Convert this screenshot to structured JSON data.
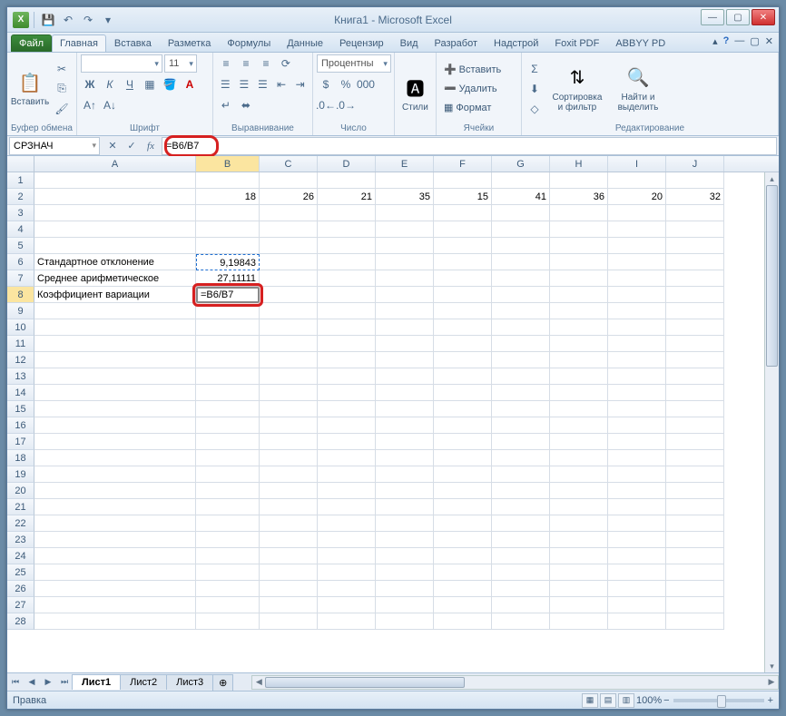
{
  "window": {
    "title": "Книга1 - Microsoft Excel"
  },
  "qat": {
    "save": "💾",
    "undo": "↶",
    "redo": "↷",
    "dd": "▾"
  },
  "winctrl": {
    "min": "—",
    "max": "▢",
    "close": "✕"
  },
  "tabs": {
    "file": "Файл",
    "items": [
      "Главная",
      "Вставка",
      "Разметка",
      "Формулы",
      "Данные",
      "Рецензир",
      "Вид",
      "Разработ",
      "Надстрой",
      "Foxit PDF",
      "ABBYY PD"
    ],
    "active": 0,
    "help": "?"
  },
  "ribbon": {
    "clipboard": {
      "paste": "Вставить",
      "label": "Буфер обмена",
      "cut": "✂",
      "copy": "⎘",
      "painter": "🖌"
    },
    "font": {
      "name": "",
      "size": "11",
      "label": "Шрифт"
    },
    "align": {
      "label": "Выравнивание"
    },
    "number": {
      "format": "Процентны",
      "label": "Число"
    },
    "styles": {
      "btn": "Стили",
      "label": ""
    },
    "cells": {
      "insert": "Вставить",
      "delete": "Удалить",
      "format": "Формат",
      "label": "Ячейки"
    },
    "editing": {
      "sort": "Сортировка и фильтр",
      "find": "Найти и выделить",
      "label": "Редактирование",
      "sum": "Σ",
      "fill": "⬇",
      "clear": "◇"
    }
  },
  "formula_bar": {
    "name_box": "СРЗНАЧ",
    "cancel": "✕",
    "enter": "✓",
    "fx": "fx",
    "formula": "=B6/B7"
  },
  "grid": {
    "columns": [
      "A",
      "B",
      "C",
      "D",
      "E",
      "F",
      "G",
      "H",
      "I",
      "J"
    ],
    "active_col": "B",
    "active_row": 8,
    "row2": {
      "B": "18",
      "C": "26",
      "D": "21",
      "E": "35",
      "F": "15",
      "G": "41",
      "H": "36",
      "I": "20",
      "J": "32"
    },
    "row6": {
      "A": "Стандартное отклонение",
      "B": "9,19843"
    },
    "row7": {
      "A": "Среднее арифметическое",
      "B": "27,11111"
    },
    "row8": {
      "A": "Коэффициент вариации",
      "B": "=B6/B7"
    },
    "visible_rows": 28
  },
  "sheets": {
    "items": [
      "Лист1",
      "Лист2",
      "Лист3"
    ],
    "active": 0,
    "add": "⊕"
  },
  "status": {
    "mode": "Правка",
    "zoom": "100%",
    "zminus": "−",
    "zplus": "+"
  }
}
